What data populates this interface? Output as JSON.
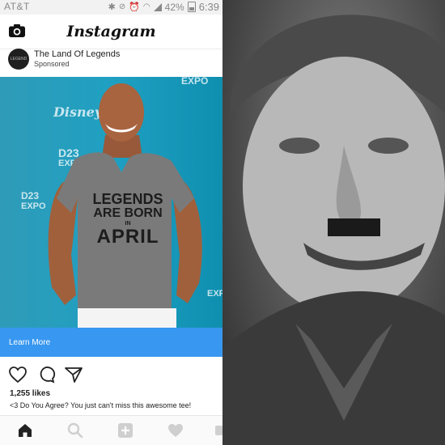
{
  "status_bar": {
    "carrier": "AT&T",
    "battery": "42%",
    "time": "6:39"
  },
  "app": {
    "logo_text": "Instagram"
  },
  "post": {
    "account_name": "The Land Of Legends",
    "sponsored_label": "Sponsored",
    "avatar_text": "LEGEND",
    "photo": {
      "shirt_text": [
        "LEGENDS",
        "ARE BORN",
        "IN",
        "APRIL"
      ],
      "watermarks": [
        "EXPO",
        "Disney",
        "D23",
        "EXPO",
        "D23",
        "EXPO",
        "EXPO"
      ]
    },
    "cta_label": "Learn More",
    "likes_text": "1,255 likes",
    "caption_text": "<3 Do You Agree? You just can't miss this awesome tee!"
  },
  "icons": {
    "camera": "camera-icon",
    "heart": "heart-icon",
    "comment": "comment-icon",
    "share": "share-icon",
    "home": "home-icon",
    "search": "search-icon",
    "add": "add-icon",
    "activity": "heart-icon"
  },
  "colors": {
    "cta_background": "#3897f0",
    "photo_background": "#1fa0c2"
  }
}
